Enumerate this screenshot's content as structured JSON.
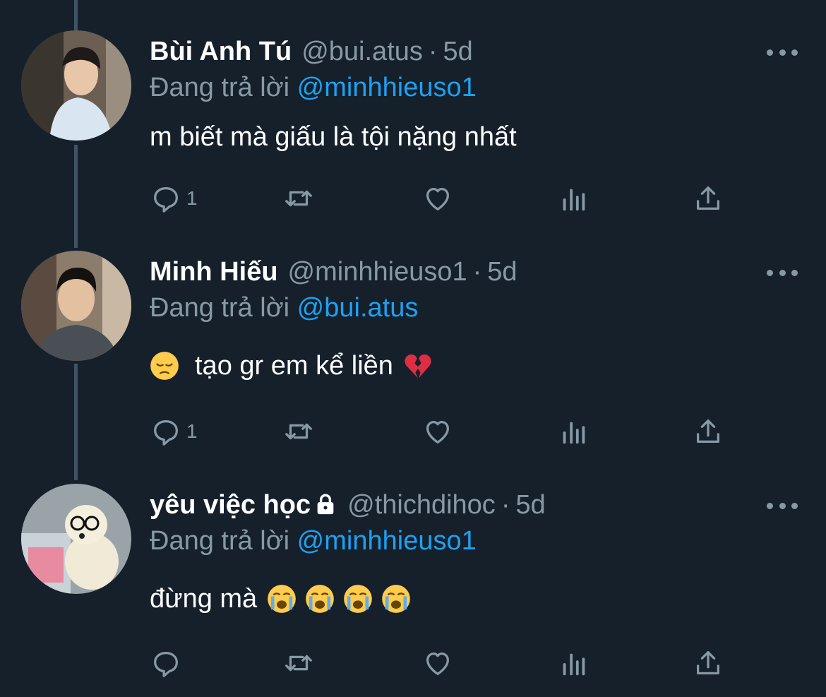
{
  "tweets": [
    {
      "name": "Bùi Anh Tú",
      "handle": "@bui.atus",
      "separator": "·",
      "time": "5d",
      "replying_prefix": "Đang trả lời ",
      "replying_to": "@minhhieuso1",
      "text": "m biết mà giấu là tội nặng nhất",
      "reply_count": "1",
      "locked": false,
      "emojis_before": [],
      "emojis_after": []
    },
    {
      "name": "Minh Hiếu",
      "handle": "@minhhieuso1",
      "separator": "·",
      "time": "5d",
      "replying_prefix": "Đang trả lời ",
      "replying_to": "@bui.atus",
      "text": "tạo gr em kể liền",
      "reply_count": "1",
      "locked": false,
      "emojis_before": [
        "pensive-face-emoji"
      ],
      "emojis_after": [
        "broken-heart-emoji"
      ]
    },
    {
      "name": "yêu việc học",
      "handle": "@thichdihoc",
      "separator": "·",
      "time": "5d",
      "replying_prefix": "Đang trả lời ",
      "replying_to": "@minhhieuso1",
      "text": "đừng mà",
      "reply_count": "",
      "locked": true,
      "emojis_before": [],
      "emojis_after": [
        "loudly-crying-face-emoji",
        "loudly-crying-face-emoji",
        "loudly-crying-face-emoji",
        "loudly-crying-face-emoji"
      ]
    }
  ],
  "icons": [
    "reply-icon",
    "retweet-icon",
    "like-icon",
    "analytics-icon",
    "share-icon",
    "more-icon",
    "lock-icon"
  ],
  "colors": {
    "background": "#15202b",
    "secondary_text": "#8899a6",
    "mention": "#1da1f2",
    "thread_line": "#3d5466"
  }
}
